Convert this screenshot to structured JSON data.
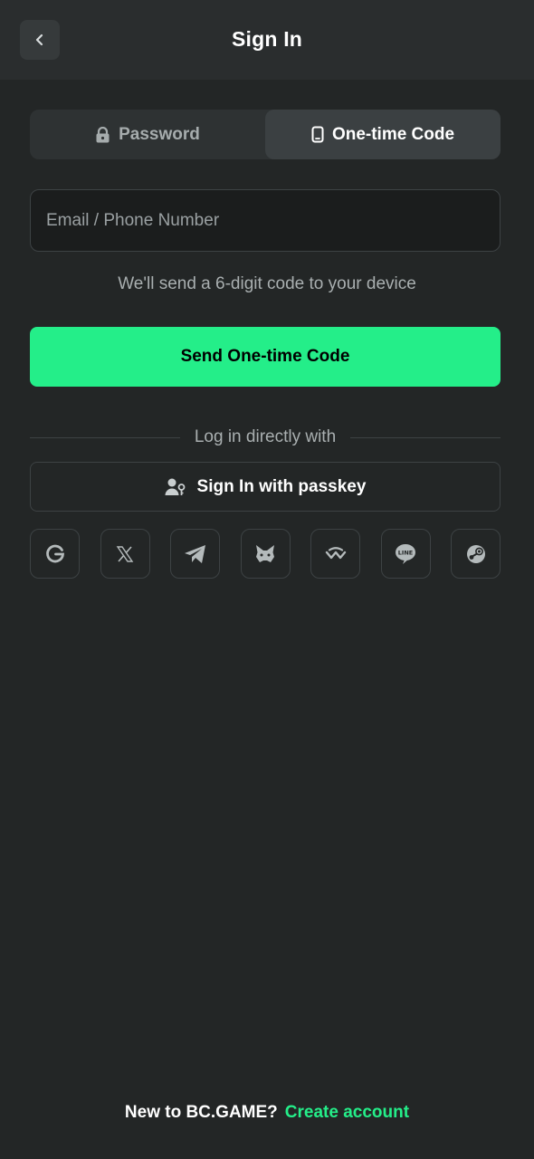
{
  "header": {
    "title": "Sign In",
    "back_icon": "chevron-left-icon"
  },
  "tabs": [
    {
      "label": "Password",
      "icon": "lock-icon",
      "active": false
    },
    {
      "label": "One-time Code",
      "icon": "phone-icon",
      "active": true
    }
  ],
  "form": {
    "identifier_placeholder": "Email / Phone Number",
    "identifier_value": "",
    "hint": "We'll send a 6-digit code to your device",
    "send_label": "Send One-time Code"
  },
  "alt_login": {
    "divider_text": "Log in directly with",
    "passkey_label": "Sign In with passkey",
    "providers": [
      "google-icon",
      "x-icon",
      "telegram-icon",
      "metamask-icon",
      "walletconnect-icon",
      "line-icon",
      "steam-icon"
    ]
  },
  "footer": {
    "question": "New to BC.GAME?",
    "link_label": "Create account"
  },
  "colors": {
    "background": "#232626",
    "header": "#2a2d2e",
    "accent": "#24ee89"
  }
}
